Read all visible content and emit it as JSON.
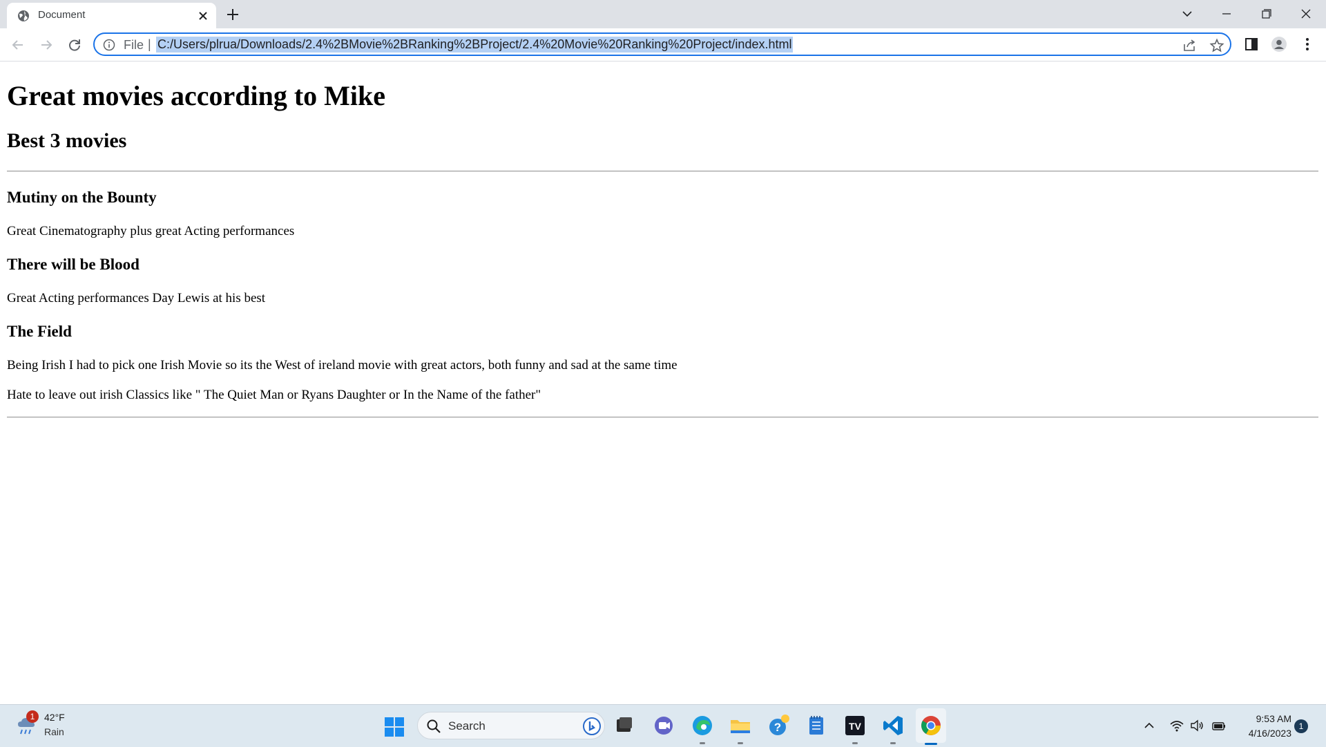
{
  "browser": {
    "tab_title": "Document",
    "omnibox_scheme": "File",
    "omnibox_separator": "|",
    "url": "C:/Users/plrua/Downloads/2.4%2BMovie%2BRanking%2BProject/2.4%20Movie%20Ranking%20Project/index.html",
    "accent_color": "#1a73e8"
  },
  "page": {
    "title": "Great movies according to Mike",
    "subtitle": "Best 3 movies",
    "movies": [
      {
        "name": "Mutiny on the Bounty",
        "description": "Great Cinematography plus great Acting performances"
      },
      {
        "name": "There will be Blood",
        "description": "Great Acting performances Day Lewis at his best"
      },
      {
        "name": "The Field",
        "description": "Being Irish I had to pick one Irish Movie so its the West of ireland movie with great actors, both funny and sad at the same time"
      }
    ],
    "footnote": "Hate to leave out irish Classics like \" The Quiet Man or Ryans Daughter or In the Name of the father\""
  },
  "taskbar": {
    "weather_temp": "42°F",
    "weather_condition": "Rain",
    "weather_badge": "1",
    "search_label": "Search",
    "time": "9:53 AM",
    "date": "4/16/2023",
    "notification_count": "1",
    "pinned_apps": [
      "edge-dev-icon",
      "meet-chat-icon",
      "edge-icon",
      "file-explorer-icon",
      "help-icon",
      "notepad-icon",
      "tradingview-icon",
      "vscode-icon",
      "chrome-icon"
    ]
  }
}
